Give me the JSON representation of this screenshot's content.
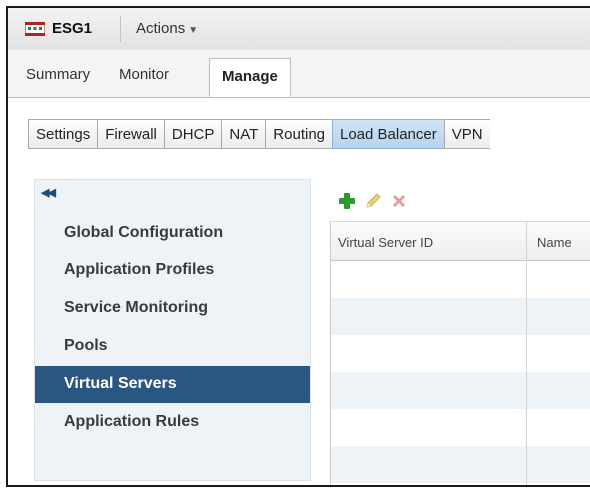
{
  "titlebar": {
    "app_title": "ESG1",
    "actions_label": "Actions"
  },
  "main_tabs": [
    {
      "label": "Summary"
    },
    {
      "label": "Monitor"
    },
    {
      "label": "Manage"
    }
  ],
  "sub_tabs": [
    {
      "label": "Settings"
    },
    {
      "label": "Firewall"
    },
    {
      "label": "DHCP"
    },
    {
      "label": "NAT"
    },
    {
      "label": "Routing"
    },
    {
      "label": "Load Balancer"
    },
    {
      "label": "VPN"
    }
  ],
  "leftnav": {
    "collapse_icon": "double-chevron-left-icon",
    "items": [
      {
        "label": "Global Configuration"
      },
      {
        "label": "Application Profiles"
      },
      {
        "label": "Service Monitoring"
      },
      {
        "label": "Pools"
      },
      {
        "label": "Virtual Servers"
      },
      {
        "label": "Application Rules"
      }
    ]
  },
  "toolbar": {
    "add_icon": "plus-icon",
    "edit_icon": "pencil-icon",
    "delete_icon": "x-icon"
  },
  "grid": {
    "columns": [
      {
        "label": "Virtual Server ID"
      },
      {
        "label": "Name"
      }
    ]
  },
  "colors": {
    "active_nav": "#2a5682",
    "active_subtab": "#bcd6f0",
    "add_green": "#2e9a2e",
    "delete_red": "#e0a0a0"
  }
}
